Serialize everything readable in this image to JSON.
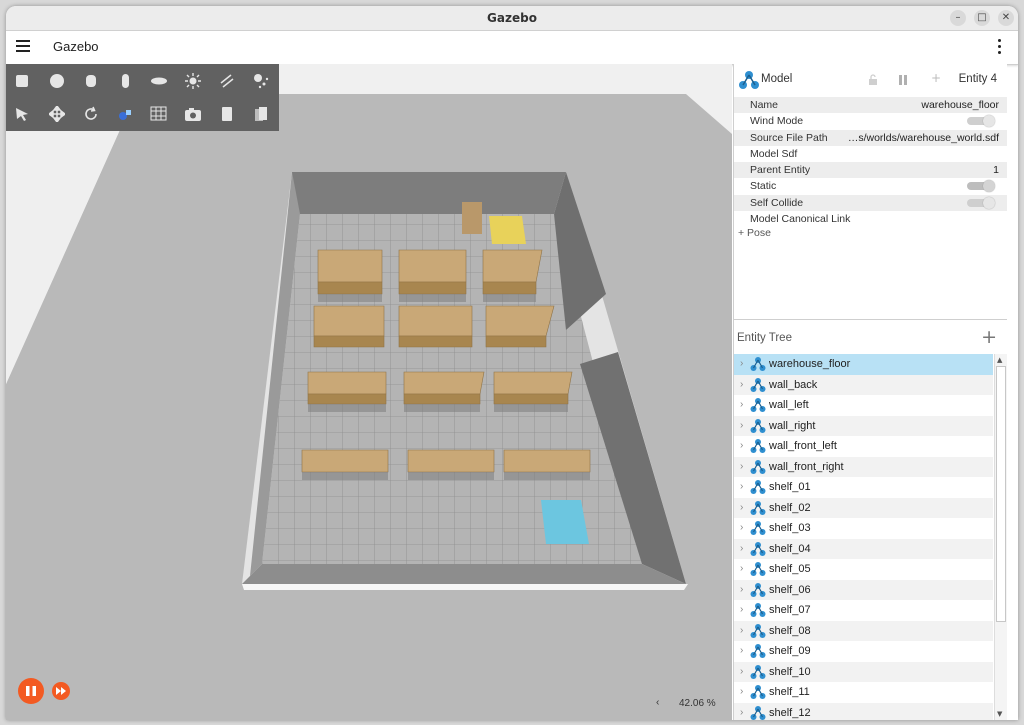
{
  "window": {
    "title": "Gazebo"
  },
  "appbar": {
    "title": "Gazebo"
  },
  "toolbar": {
    "row1": [
      "box-icon",
      "sphere-icon",
      "cylinder-icon",
      "capsule-icon",
      "ellipsoid-icon",
      "sun-light-icon",
      "directional-light-icon",
      "spot-light-icon"
    ],
    "row2": [
      "select-icon",
      "translate-icon",
      "rotate-icon",
      "transform-control-icon",
      "grid-icon",
      "screenshot-icon",
      "copy-icon",
      "paste-icon"
    ]
  },
  "view": {
    "zoom": "42.06 %",
    "zoom_prev": "‹"
  },
  "component_inspector": {
    "type": "Model",
    "entity": "Entity 4",
    "plus": "+",
    "rows": [
      {
        "key": "Name",
        "value": "warehouse_floor"
      },
      {
        "key": "Wind Mode",
        "value": ""
      },
      {
        "key": "Source File Path",
        "value": "…s/worlds/warehouse_world.sdf"
      },
      {
        "key": "Model Sdf",
        "value": ""
      },
      {
        "key": "Parent Entity",
        "value": "1"
      },
      {
        "key": "Static",
        "value": ""
      },
      {
        "key": "Self Collide",
        "value": ""
      },
      {
        "key": "Model Canonical Link",
        "value": ""
      }
    ],
    "pose": "+ Pose"
  },
  "entity_tree": {
    "title": "Entity Tree",
    "add": "+",
    "items": [
      "warehouse_floor",
      "wall_back",
      "wall_left",
      "wall_right",
      "wall_front_left",
      "wall_front_right",
      "shelf_01",
      "shelf_02",
      "shelf_03",
      "shelf_04",
      "shelf_05",
      "shelf_06",
      "shelf_07",
      "shelf_08",
      "shelf_09",
      "shelf_10",
      "shelf_11",
      "shelf_12"
    ]
  },
  "colors": {
    "accent": "#f35a22",
    "selection": "#b8e1f5",
    "toolbar": "#616161",
    "shelf": "#c9a877",
    "yellow_pad": "#e8d25a",
    "blue_pad": "#6cc6e0"
  }
}
